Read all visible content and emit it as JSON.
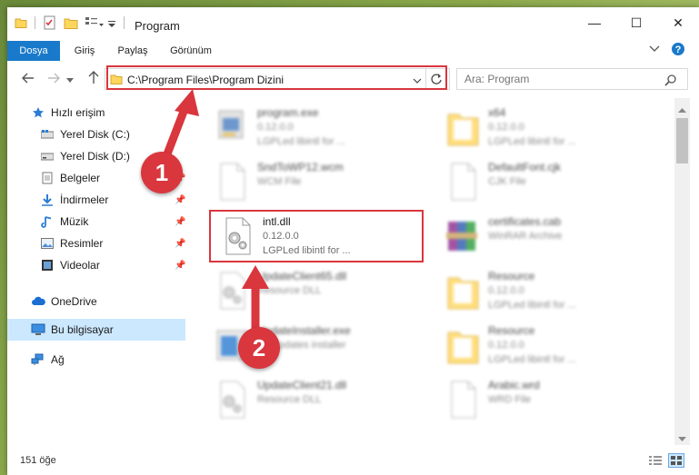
{
  "window": {
    "title": "Program",
    "controls": {
      "minimize": "—",
      "maximize": "☐",
      "close": "✕"
    }
  },
  "ribbon": {
    "tabs": [
      {
        "label": "Dosya",
        "active": true
      },
      {
        "label": "Giriş"
      },
      {
        "label": "Paylaş"
      },
      {
        "label": "Görünüm"
      }
    ],
    "expand_icon": "chevron-down-icon",
    "help_icon": "help-icon"
  },
  "navigation": {
    "address": "C:\\Program Files\\Program Dizini",
    "search_placeholder": "Ara: Program"
  },
  "sidebar": {
    "items": [
      {
        "label": "Hızlı erişim",
        "icon": "star-icon"
      },
      {
        "label": "Yerel Disk (C:)",
        "icon": "drive-icon",
        "pinned": true
      },
      {
        "label": "Yerel Disk (D:)",
        "icon": "drive-icon",
        "pinned": true
      },
      {
        "label": "Belgeler",
        "icon": "documents-icon",
        "pinned": true
      },
      {
        "label": "İndirmeler",
        "icon": "download-icon",
        "pinned": true
      },
      {
        "label": "Müzik",
        "icon": "music-icon",
        "pinned": true
      },
      {
        "label": "Resimler",
        "icon": "pictures-icon",
        "pinned": true
      },
      {
        "label": "Videolar",
        "icon": "video-icon",
        "pinned": true
      },
      {
        "label": "OneDrive",
        "icon": "cloud-icon"
      },
      {
        "label": "Bu bilgisayar",
        "icon": "computer-icon",
        "selected": true
      },
      {
        "label": "Ağ",
        "icon": "network-icon"
      }
    ]
  },
  "files": [
    {
      "name": "program.exe",
      "line2": "0.12.0.0",
      "line3": "LGPLed libintl for ...",
      "icon": "exe-icon"
    },
    {
      "name": "x64",
      "line2": "0.12.0.0",
      "line3": "LGPLed libintl for ...",
      "icon": "folder-icon"
    },
    {
      "name": "SndToWP12.wcm",
      "line2": "WCM File",
      "line3": "",
      "icon": "file-icon"
    },
    {
      "name": "DefaultFont.cjk",
      "line2": "CJK File",
      "line3": "",
      "icon": "file-icon"
    },
    {
      "name": "intl.dll",
      "line2": "0.12.0.0",
      "line3": "LGPLed libintl for ...",
      "icon": "dll-icon",
      "highlighted": true
    },
    {
      "name": "certificates.cab",
      "line2": "WinRAR Archive",
      "line3": "",
      "icon": "archive-icon"
    },
    {
      "name": "UpdateClient65.dll",
      "line2": "Resource DLL",
      "line3": "",
      "icon": "dll-icon"
    },
    {
      "name": "Resource",
      "line2": "0.12.0.0",
      "line3": "LGPLed libintl for ...",
      "icon": "folder-icon"
    },
    {
      "name": "UpdateInstaller.exe",
      "line2": "BY updates installer",
      "line3": "",
      "icon": "exe-icon"
    },
    {
      "name": "Resource",
      "line2": "0.12.0.0",
      "line3": "LGPLed libintl for ...",
      "icon": "folder-icon"
    },
    {
      "name": "UpdateClient21.dll",
      "line2": "Resource DLL",
      "line3": "",
      "icon": "dll-icon"
    },
    {
      "name": "Arabic.wrd",
      "line2": "WRD File",
      "line3": "",
      "icon": "file-icon"
    }
  ],
  "status": {
    "item_count": "151 öğe"
  },
  "annotations": {
    "step1": "1",
    "step2": "2",
    "color": "#d9363e"
  }
}
